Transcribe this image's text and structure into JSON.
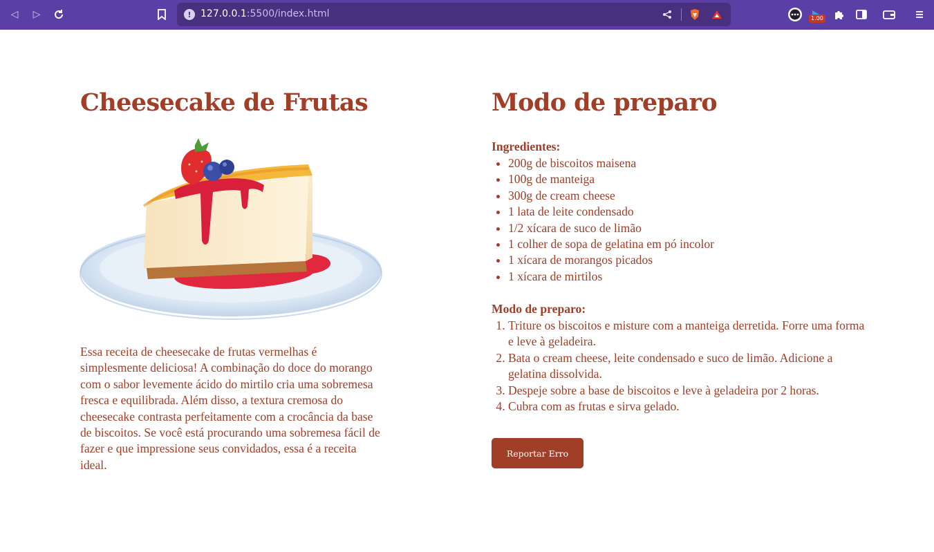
{
  "browser": {
    "url_host": "127.0.0.1",
    "url_path": ":5500/index.html",
    "extension_badge": "1.00"
  },
  "recipe": {
    "title": "Cheesecake de Frutas",
    "description": "Essa receita de cheesecake de frutas vermelhas é simplesmente deliciosa! A combinação do doce do morango com o sabor levemente ácido do mirtilo cria uma sobremesa fresca e equilibrada. Além disso, a textura cremosa do cheesecake contrasta perfeitamente com a crocância da base de biscoitos. Se você está procurando uma sobremesa fácil de fazer e que impressione seus convidados, essa é a receita ideal."
  },
  "preparation": {
    "title": "Modo de preparo",
    "ingredients_label": "Ingredientes:",
    "ingredients": [
      "200g de biscoitos maisena",
      "100g de manteiga",
      "300g de cream cheese",
      "1 lata de leite condensado",
      "1/2 xícara de suco de limão",
      "1 colher de sopa de gelatina em pó incolor",
      "1 xícara de morangos picados",
      "1 xícara de mirtilos"
    ],
    "steps_label": "Modo de preparo:",
    "steps": [
      "Triture os biscoitos e misture com a manteiga derretida. Forre uma forma e leve à geladeira.",
      "Bata o cream cheese, leite condensado e suco de limão. Adicione a gelatina dissolvida.",
      "Despeje sobre a base de biscoitos e leve à geladeira por 2 horas.",
      "Cubra com as frutas e sirva gelado."
    ],
    "report_button": "Reportar Erro"
  },
  "colors": {
    "accent": "#a13e28",
    "browser_bar": "#5b3fa6"
  }
}
